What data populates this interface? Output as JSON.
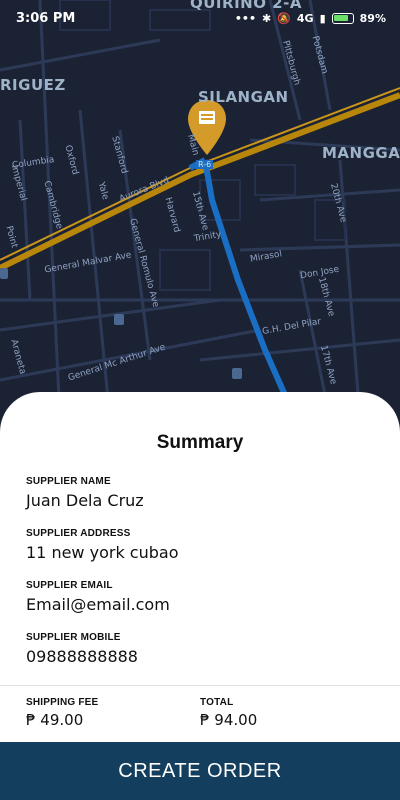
{
  "status_bar": {
    "time": "3:06 PM",
    "network": "4G",
    "battery": "89%"
  },
  "map": {
    "areas": [
      "QUIRINO 2-A",
      "RIGUEZ",
      "SILANGAN",
      "MANGGA"
    ],
    "streets": [
      "Columbia",
      "Oxford",
      "Stanford",
      "Yale",
      "Cambridge",
      "Point",
      "Pittsburgh",
      "Potsdam",
      "Aurora Blvd",
      "R-6",
      "Harvard",
      "15th Ave",
      "Trinity",
      "General Malvar Ave",
      "General Romulo Ave",
      "Mirasol",
      "Don Jose",
      "18th Ave",
      "20th Ave",
      "G.H. Del Pilar",
      "17th Ave",
      "General Mc Arthur Ave",
      "Araneta",
      "Imperial",
      "Main"
    ],
    "marker_icon": "store-pin-icon",
    "colors": {
      "map_bg": "#1b2233",
      "road": "#2a3a5c",
      "highway": "#b8860b",
      "route": "#1a6fc4"
    }
  },
  "summary": {
    "title": "Summary",
    "supplier_name_label": "SUPPLIER NAME",
    "supplier_name": "Juan Dela Cruz",
    "supplier_address_label": "SUPPLIER ADDRESS",
    "supplier_address": "11 new york cubao",
    "supplier_email_label": "SUPPLIER EMAIL",
    "supplier_email": "Email@email.com",
    "supplier_mobile_label": "SUPPLIER MOBILE",
    "supplier_mobile": "09888888888",
    "shipping_fee_label": "SHIPPING FEE",
    "shipping_fee": "₱ 49.00",
    "total_label": "TOTAL",
    "total": "₱ 94.00"
  },
  "actions": {
    "create_order": "CREATE ORDER",
    "button_color": "#143e5e"
  }
}
